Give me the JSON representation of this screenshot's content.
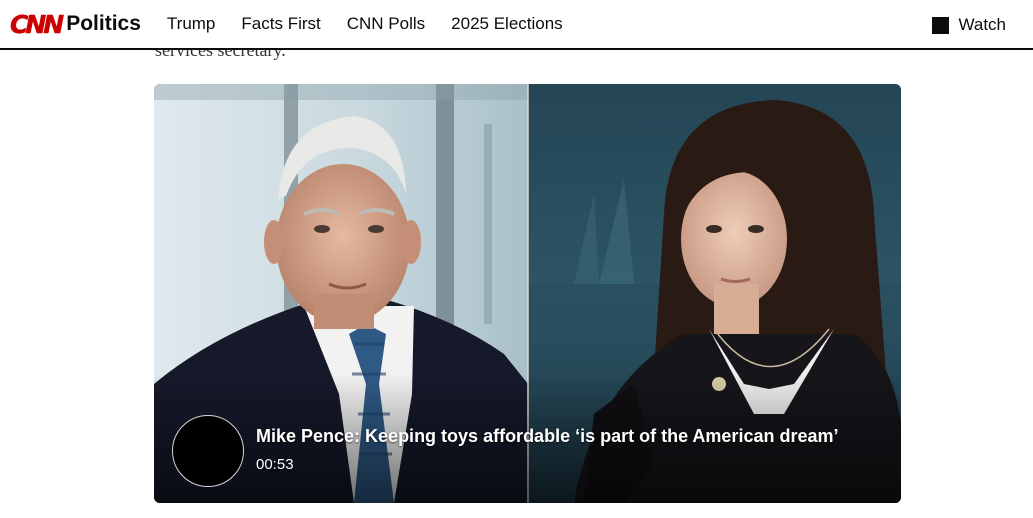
{
  "header": {
    "logo_text": "CNN",
    "section": "Politics",
    "nav_items": [
      "Trump",
      "Facts First",
      "CNN Polls",
      "2025 Elections"
    ],
    "watch_label": "Watch"
  },
  "article": {
    "partial_text": "services secretary."
  },
  "video": {
    "title": "Mike Pence: Keeping toys affordable ‘is part of the American dream’",
    "duration": "00:53"
  },
  "colors": {
    "brand_red": "#cc0000",
    "text_dark": "#0c0c0c"
  },
  "icons": [
    "cnn-logo",
    "watch-icon",
    "play-icon"
  ]
}
